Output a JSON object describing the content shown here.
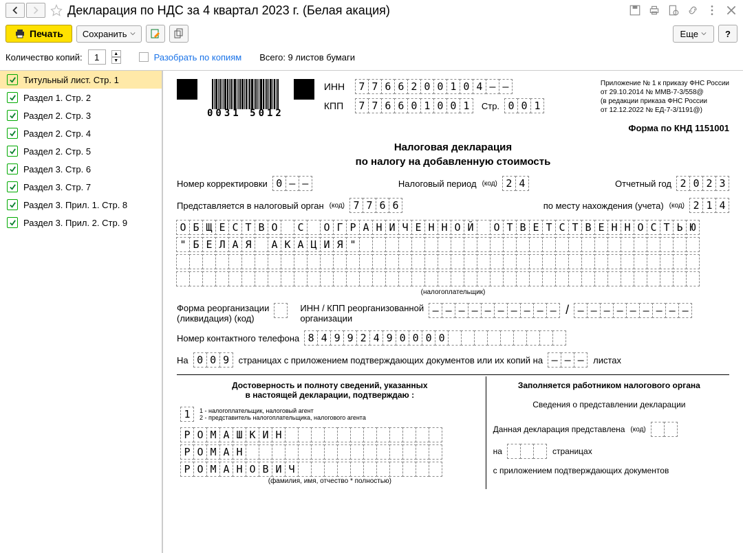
{
  "title": "Декларация по НДС за 4 квартал 2023 г. (Белая акация)",
  "toolbar": {
    "print": "Печать",
    "save": "Сохранить",
    "more": "Еще",
    "help": "?"
  },
  "copies": {
    "label": "Количество копий:",
    "value": "1",
    "split_label": "Разобрать по копиям",
    "total": "Всего: 9 листов бумаги"
  },
  "sidebar": [
    {
      "label": "Титульный лист. Стр. 1",
      "selected": true
    },
    {
      "label": "Раздел 1. Стр. 2"
    },
    {
      "label": "Раздел 2. Стр. 3"
    },
    {
      "label": "Раздел 2. Стр. 4"
    },
    {
      "label": "Раздел 2. Стр. 5"
    },
    {
      "label": "Раздел 3. Стр. 6"
    },
    {
      "label": "Раздел 3. Стр. 7"
    },
    {
      "label": "Раздел 3. Прил. 1. Стр. 8"
    },
    {
      "label": "Раздел 3. Прил. 2. Стр. 9"
    }
  ],
  "form": {
    "barcode": "0031 5012",
    "inn_label": "ИНН",
    "inn": "7766200104--",
    "kpp_label": "КПП",
    "kpp": "776601001",
    "page_label": "Стр.",
    "page": "001",
    "appendix_lines": [
      "Приложение № 1 к приказу ФНС России",
      "от 29.10.2014 № ММВ-7-3/558@",
      "(в редакции приказа ФНС России",
      "от 12.12.2022 № ЕД-7-3/1191@)"
    ],
    "knd": "Форма по КНД 1151001",
    "doc_title1": "Налоговая декларация",
    "doc_title2": "по налогу на добавленную стоимость",
    "corr_label": "Номер корректировки",
    "corr": "0--",
    "period_label": "Налоговый период",
    "code_suffix": "(код)",
    "period": "24",
    "year_label": "Отчетный год",
    "year": "2023",
    "auth_label": "Представляется в налоговый орган",
    "auth": "7766",
    "loc_label": "по месту нахождения (учета)",
    "loc": "214",
    "org_line1": "ОБЩЕСТВО С ОГРАНИЧЕННОЙ ОТВЕТСТВЕННОСТЬЮ",
    "org_line2": "\"БЕЛАЯ АКАЦИЯ\"",
    "taxpayer_caption": "(налогоплательщик)",
    "reorg_label1": "Форма реорганизации",
    "reorg_label2": "(ликвидация) (код)",
    "reorg_inn_label1": "ИНН / КПП реорганизованной",
    "reorg_inn_label2": "организации",
    "reorg_inn": "----------",
    "reorg_kpp": "---------",
    "phone_label": "Номер контактного телефона",
    "phone": "84992490000",
    "pages_prefix": "На",
    "pages": "009",
    "pages_text": "страницах с приложением подтверждающих документов или их копий на",
    "attach": "---",
    "attach_suffix": "листах",
    "confirm_title1": "Достоверность и полноту сведений, указанных",
    "confirm_title2": "в настоящей декларации, подтверждаю :",
    "confirm_code": "1",
    "confirm_note1": "1 - налогоплательщик, налоговый агент",
    "confirm_note2": "2 - представитель налогоплательщика, налогового агента",
    "surname": "РОМАШКИН",
    "name": "РОМАН",
    "patronymic": "РОМАНОВИЧ",
    "fio_caption": "(фамилия, имя, отчество * полностью)",
    "auth_fill_title": "Заполняется работником налогового органа",
    "auth_info": "Сведения о представлении декларации",
    "decl_presented_label": "Данная декларация представлена",
    "na_label": "на",
    "pages_word": "страницах",
    "attach_docs": "c приложением подтверждающих документов"
  }
}
